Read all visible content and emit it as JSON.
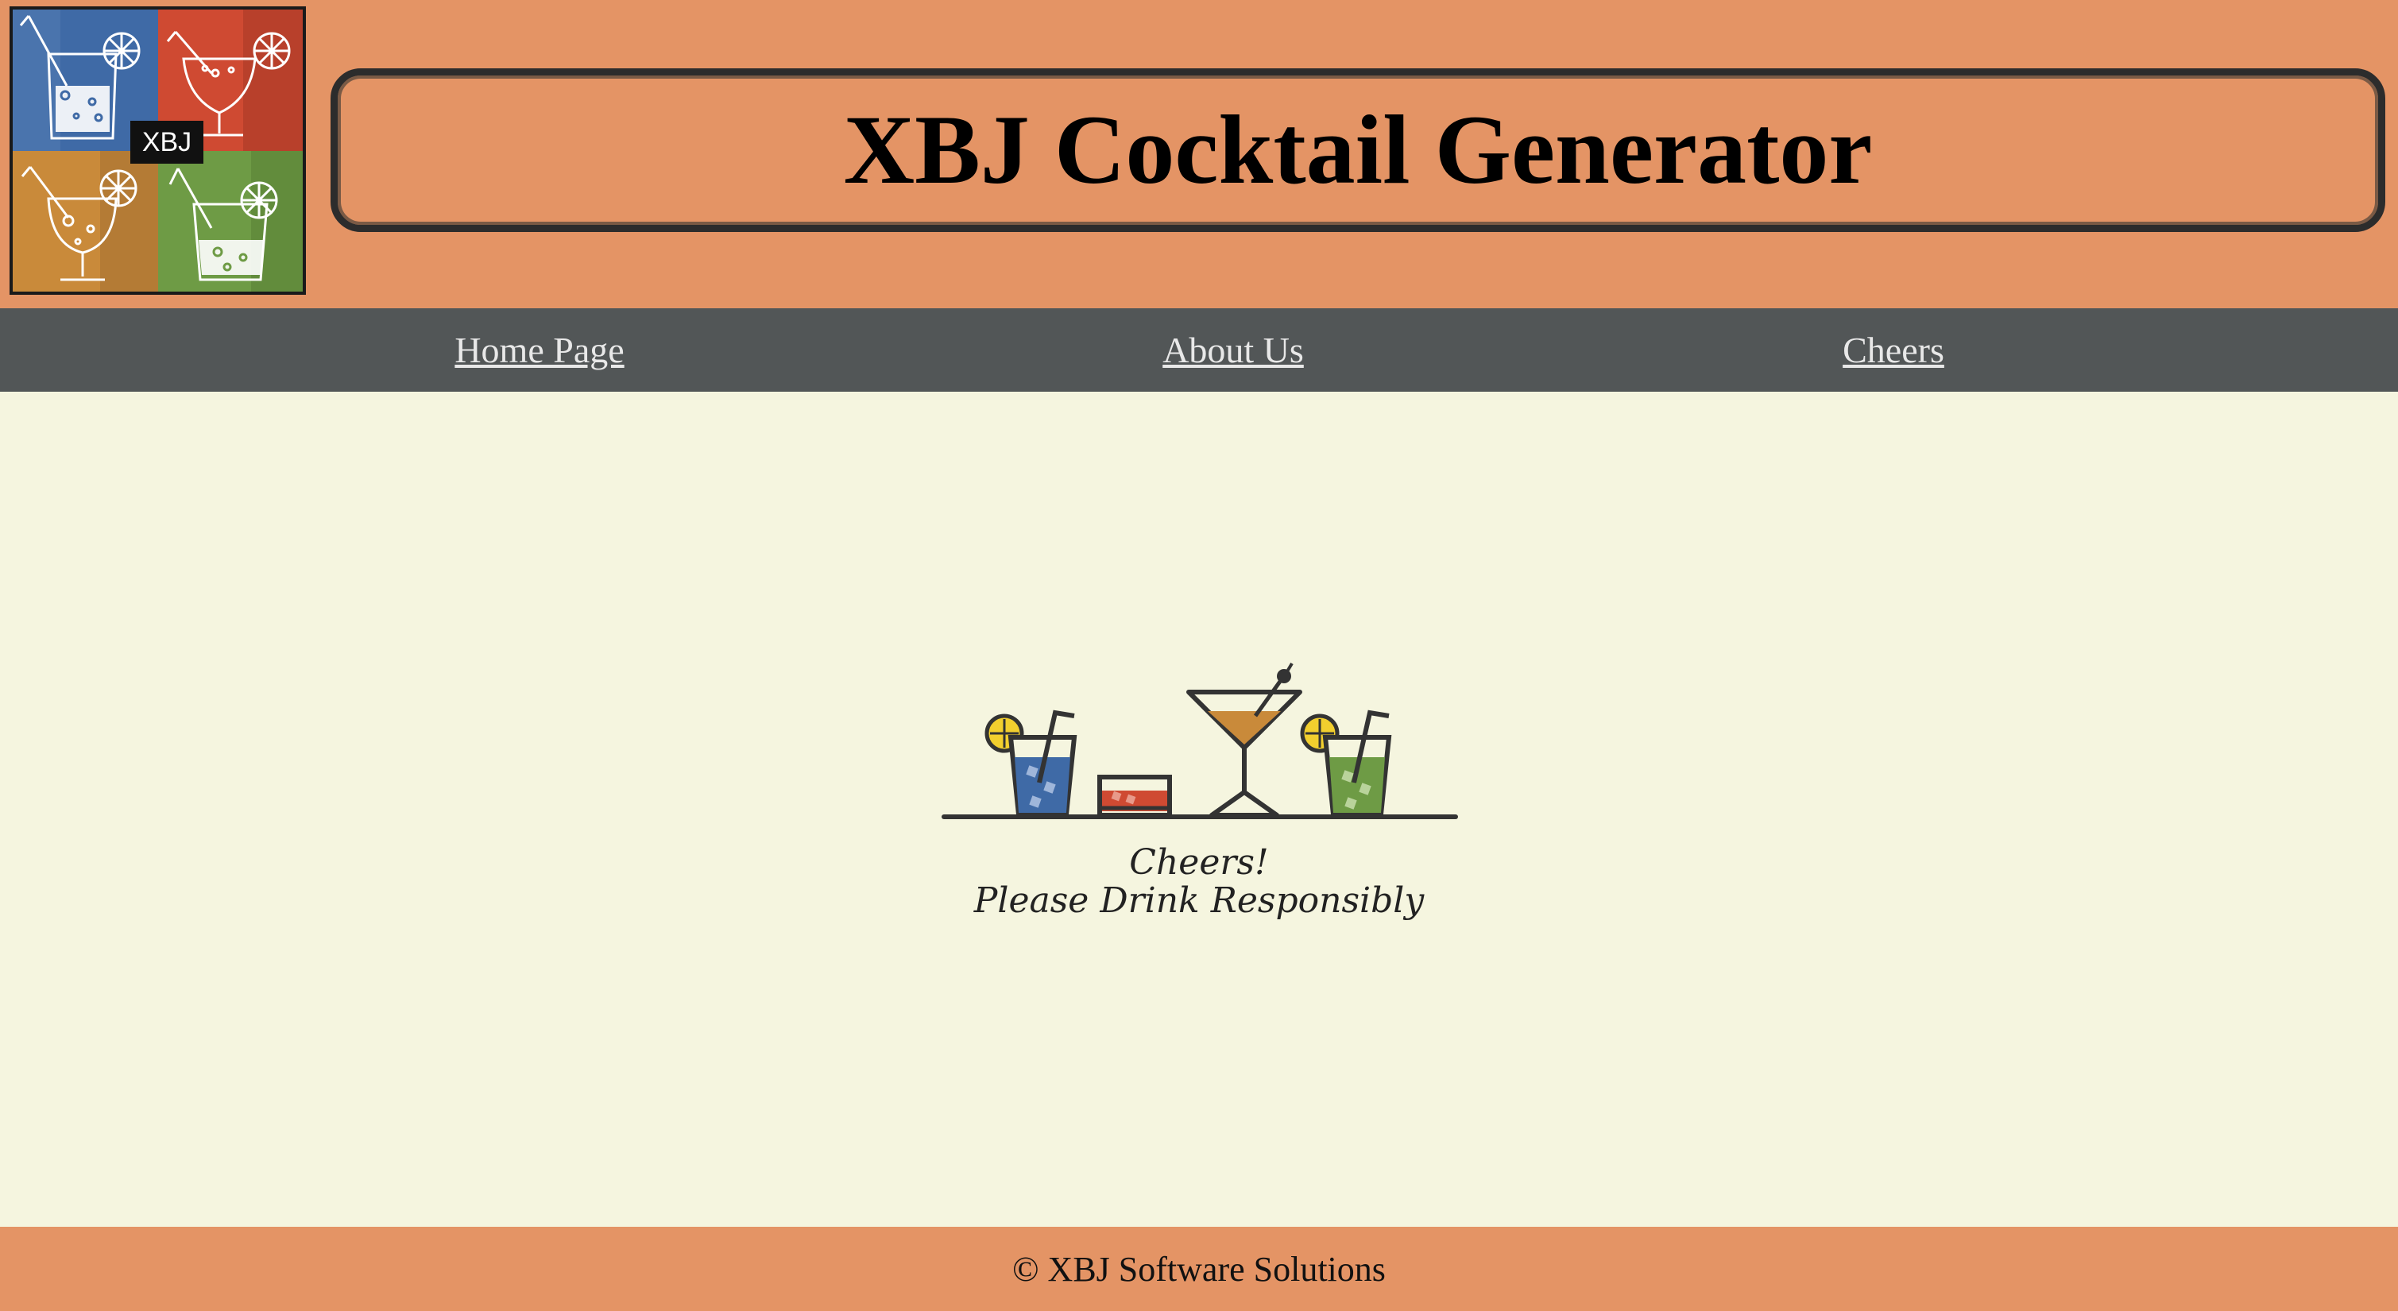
{
  "header": {
    "title": "XBJ Cocktail Generator",
    "logo_badge": "XBJ"
  },
  "nav": {
    "items": [
      {
        "label": "Home Page"
      },
      {
        "label": "About Us"
      },
      {
        "label": "Cheers"
      }
    ]
  },
  "main": {
    "illustration": "cocktail-glasses-icon",
    "line1": "Cheers!",
    "line2": "Please Drink Responsibly"
  },
  "footer": {
    "text": "© XBJ Software Solutions"
  },
  "colors": {
    "header_bg": "#e49465",
    "nav_bg": "#525657",
    "page_bg": "#f5f5df",
    "blue": "#3f6aa6",
    "red": "#cf4a32",
    "orange": "#c98a3a",
    "green": "#6e9b45"
  }
}
